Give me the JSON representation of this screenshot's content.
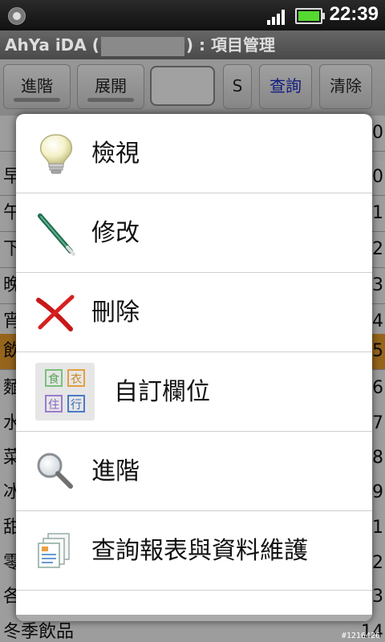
{
  "status_bar": {
    "time": "22:39"
  },
  "title_bar": {
    "title_prefix": "AhYa iDA (",
    "title_suffix": ") : 項目管理"
  },
  "toolbar": {
    "advanced_label": "進階",
    "expand_label": "展開",
    "search_value": "",
    "s_label": "S",
    "query_label": "查詢",
    "clear_label": "清除"
  },
  "background_list": {
    "rows": [
      {
        "text": "",
        "num": "0"
      },
      {
        "text": "早",
        "num": "0"
      },
      {
        "text": "午",
        "num": "1"
      },
      {
        "text": "下",
        "num": "2"
      },
      {
        "text": "晚",
        "num": "3"
      },
      {
        "text": "宵",
        "num": "4"
      },
      {
        "text": "飲",
        "num": "5"
      },
      {
        "text": "麵",
        "num": "6"
      },
      {
        "text": "水",
        "num": "7"
      },
      {
        "text": "菜",
        "num": "8"
      },
      {
        "text": "冰",
        "num": "9"
      },
      {
        "text": "甜",
        "num": "1"
      },
      {
        "text": "零",
        "num": "2"
      },
      {
        "text": "各",
        "num": "3"
      }
    ],
    "bottom_text": "冬季飲品",
    "bottom_num": "14"
  },
  "menu": {
    "items": [
      {
        "label": "檢視",
        "icon": "lightbulb-icon"
      },
      {
        "label": "修改",
        "icon": "pen-icon"
      },
      {
        "label": "刪除",
        "icon": "delete-x-icon"
      },
      {
        "label": "自訂欄位",
        "icon": "custom-fields-icon",
        "grid": [
          "食",
          "衣",
          "住",
          "行"
        ]
      },
      {
        "label": "進階",
        "icon": "magnifier-icon"
      },
      {
        "label": "查詢報表與資料維護",
        "icon": "report-docs-icon"
      }
    ]
  },
  "watermark": "#1216426",
  "colors": {
    "highlight": "#e79b2c",
    "query_blue": "#1a2cc0",
    "battery": "#55d830"
  }
}
